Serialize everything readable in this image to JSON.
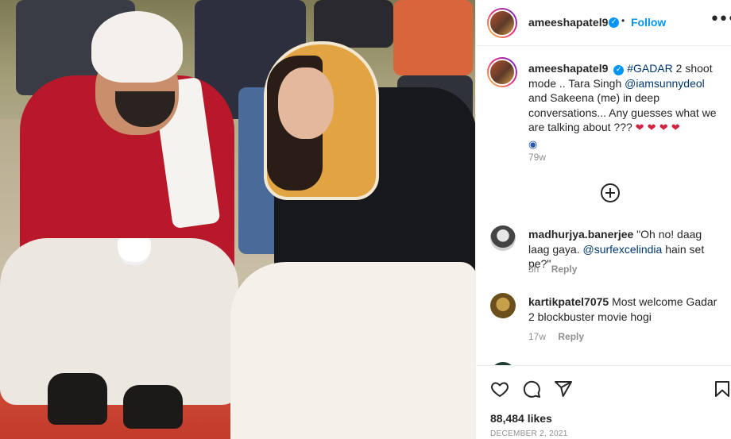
{
  "post": {
    "username": "ameeshapatel9",
    "follow_label": "Follow",
    "separator": "•",
    "more_label": "•••"
  },
  "caption": {
    "username": "ameeshapatel9",
    "hashtag": "#GADAR",
    "text_1": " 2 shoot mode .. Tara Singh ",
    "mention": "@iamsunnydeol",
    "text_2": " and Sakeena (me) in deep conversations... Any guesses what we are talking about ??? ",
    "emojis_line1": "❤ ❤ ❤ ❤ ",
    "emojis_line2": "◉",
    "time": "79w"
  },
  "comments": [
    {
      "username": "madhurjya.banerjee",
      "text_1": " \"Oh no! daag laag gaya. ",
      "mention": "@surfexcelindia",
      "text_2": " hain set pe?\"",
      "time": "5h",
      "reply_label": "Reply"
    },
    {
      "username": "kartikpatel7075",
      "text_1": " Most welcome Gadar 2 blockbuster movie hogi",
      "time": "17w",
      "reply_label": "Reply"
    }
  ],
  "likes": "88,484 likes",
  "date": "DECEMBER 2, 2021",
  "icons": [
    "verified-icon",
    "more-icon",
    "add-comment-icon",
    "heart-icon",
    "comment-icon",
    "share-icon",
    "bookmark-icon"
  ],
  "colors": {
    "accent": "#0095f6",
    "mention": "#00376b",
    "muted": "#8e8e8e"
  }
}
